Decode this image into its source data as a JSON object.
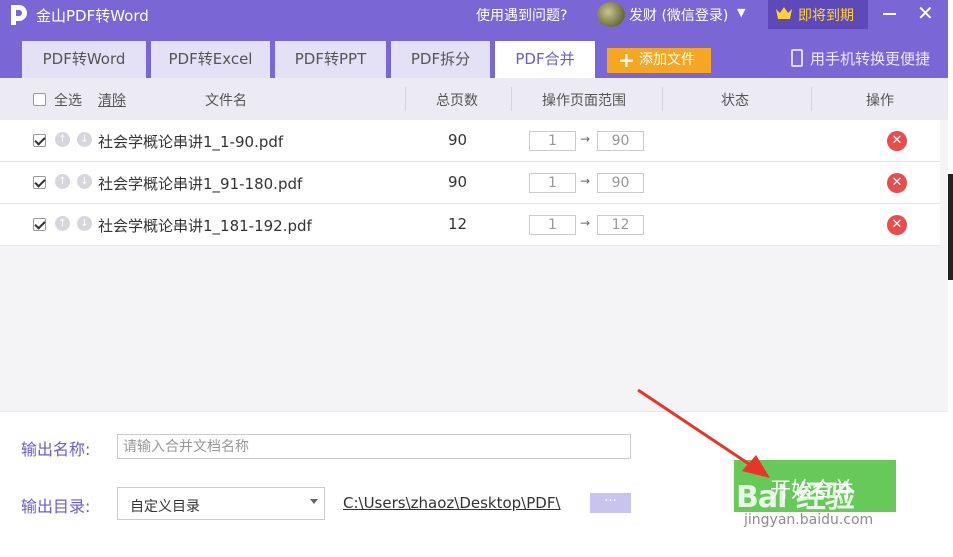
{
  "app": {
    "title": "金山PDF转Word",
    "help_link": "使用遇到问题?",
    "user_name": "发财 (微信登录)",
    "vip_label": "即将到期"
  },
  "tabs": [
    {
      "label": "PDF转Word",
      "active": false
    },
    {
      "label": "PDF转Excel",
      "active": false
    },
    {
      "label": "PDF转PPT",
      "active": false
    },
    {
      "label": "PDF拆分",
      "active": false
    },
    {
      "label": "PDF合并",
      "active": true
    }
  ],
  "toolbar": {
    "add_file_label": "添加文件",
    "phone_convert_label": "用手机转换更便捷"
  },
  "table": {
    "select_all": "全选",
    "clear": "清除",
    "col_filename": "文件名",
    "col_pages": "总页数",
    "col_range": "操作页面范围",
    "col_status": "状态",
    "col_action": "操作",
    "rows": [
      {
        "checked": true,
        "filename": "社会学概论串讲1_1-90.pdf",
        "pages": "90",
        "range_from": "1",
        "range_to": "90",
        "status": ""
      },
      {
        "checked": true,
        "filename": "社会学概论串讲1_91-180.pdf",
        "pages": "90",
        "range_from": "1",
        "range_to": "90",
        "status": ""
      },
      {
        "checked": true,
        "filename": "社会学概论串讲1_181-192.pdf",
        "pages": "12",
        "range_from": "1",
        "range_to": "12",
        "status": ""
      }
    ]
  },
  "output": {
    "name_label": "输出名称:",
    "name_placeholder": "请输入合并文档名称",
    "dir_label": "输出目录:",
    "dir_option": "自定义目录",
    "dir_path": "C:\\Users\\zhaoz\\Desktop\\PDF\\",
    "browse_label": "···"
  },
  "actions": {
    "start_label": "开始合并"
  },
  "watermark": {
    "brand": "Bai 经验",
    "url": "jingyan.baidu.com"
  },
  "colors": {
    "brand_purple": "#7b66d6",
    "accent_orange": "#f5a623",
    "start_green": "#66c95a",
    "delete_red": "#e84c4c",
    "annotation_arrow": "#e8352c"
  },
  "icons": {
    "logo": "pdf-logo-icon",
    "crown": "crown-icon",
    "phone": "phone-icon",
    "move_up": "arrow-up-icon",
    "move_down": "arrow-down-icon",
    "delete": "close-circle-icon"
  }
}
